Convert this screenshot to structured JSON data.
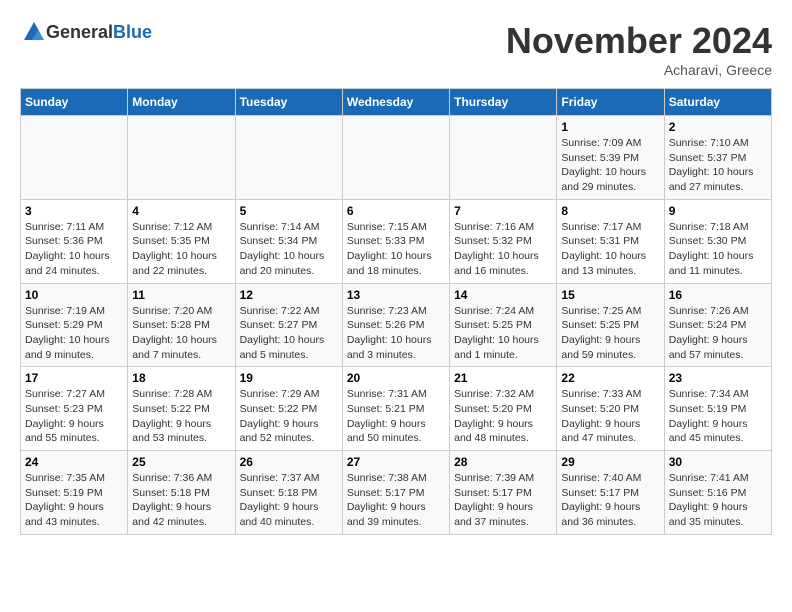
{
  "header": {
    "logo_general": "General",
    "logo_blue": "Blue",
    "month_title": "November 2024",
    "location": "Acharavi, Greece"
  },
  "days_of_week": [
    "Sunday",
    "Monday",
    "Tuesday",
    "Wednesday",
    "Thursday",
    "Friday",
    "Saturday"
  ],
  "weeks": [
    [
      {
        "day": "",
        "info": ""
      },
      {
        "day": "",
        "info": ""
      },
      {
        "day": "",
        "info": ""
      },
      {
        "day": "",
        "info": ""
      },
      {
        "day": "",
        "info": ""
      },
      {
        "day": "1",
        "info": "Sunrise: 7:09 AM\nSunset: 5:39 PM\nDaylight: 10 hours and 29 minutes."
      },
      {
        "day": "2",
        "info": "Sunrise: 7:10 AM\nSunset: 5:37 PM\nDaylight: 10 hours and 27 minutes."
      }
    ],
    [
      {
        "day": "3",
        "info": "Sunrise: 7:11 AM\nSunset: 5:36 PM\nDaylight: 10 hours and 24 minutes."
      },
      {
        "day": "4",
        "info": "Sunrise: 7:12 AM\nSunset: 5:35 PM\nDaylight: 10 hours and 22 minutes."
      },
      {
        "day": "5",
        "info": "Sunrise: 7:14 AM\nSunset: 5:34 PM\nDaylight: 10 hours and 20 minutes."
      },
      {
        "day": "6",
        "info": "Sunrise: 7:15 AM\nSunset: 5:33 PM\nDaylight: 10 hours and 18 minutes."
      },
      {
        "day": "7",
        "info": "Sunrise: 7:16 AM\nSunset: 5:32 PM\nDaylight: 10 hours and 16 minutes."
      },
      {
        "day": "8",
        "info": "Sunrise: 7:17 AM\nSunset: 5:31 PM\nDaylight: 10 hours and 13 minutes."
      },
      {
        "day": "9",
        "info": "Sunrise: 7:18 AM\nSunset: 5:30 PM\nDaylight: 10 hours and 11 minutes."
      }
    ],
    [
      {
        "day": "10",
        "info": "Sunrise: 7:19 AM\nSunset: 5:29 PM\nDaylight: 10 hours and 9 minutes."
      },
      {
        "day": "11",
        "info": "Sunrise: 7:20 AM\nSunset: 5:28 PM\nDaylight: 10 hours and 7 minutes."
      },
      {
        "day": "12",
        "info": "Sunrise: 7:22 AM\nSunset: 5:27 PM\nDaylight: 10 hours and 5 minutes."
      },
      {
        "day": "13",
        "info": "Sunrise: 7:23 AM\nSunset: 5:26 PM\nDaylight: 10 hours and 3 minutes."
      },
      {
        "day": "14",
        "info": "Sunrise: 7:24 AM\nSunset: 5:25 PM\nDaylight: 10 hours and 1 minute."
      },
      {
        "day": "15",
        "info": "Sunrise: 7:25 AM\nSunset: 5:25 PM\nDaylight: 9 hours and 59 minutes."
      },
      {
        "day": "16",
        "info": "Sunrise: 7:26 AM\nSunset: 5:24 PM\nDaylight: 9 hours and 57 minutes."
      }
    ],
    [
      {
        "day": "17",
        "info": "Sunrise: 7:27 AM\nSunset: 5:23 PM\nDaylight: 9 hours and 55 minutes."
      },
      {
        "day": "18",
        "info": "Sunrise: 7:28 AM\nSunset: 5:22 PM\nDaylight: 9 hours and 53 minutes."
      },
      {
        "day": "19",
        "info": "Sunrise: 7:29 AM\nSunset: 5:22 PM\nDaylight: 9 hours and 52 minutes."
      },
      {
        "day": "20",
        "info": "Sunrise: 7:31 AM\nSunset: 5:21 PM\nDaylight: 9 hours and 50 minutes."
      },
      {
        "day": "21",
        "info": "Sunrise: 7:32 AM\nSunset: 5:20 PM\nDaylight: 9 hours and 48 minutes."
      },
      {
        "day": "22",
        "info": "Sunrise: 7:33 AM\nSunset: 5:20 PM\nDaylight: 9 hours and 47 minutes."
      },
      {
        "day": "23",
        "info": "Sunrise: 7:34 AM\nSunset: 5:19 PM\nDaylight: 9 hours and 45 minutes."
      }
    ],
    [
      {
        "day": "24",
        "info": "Sunrise: 7:35 AM\nSunset: 5:19 PM\nDaylight: 9 hours and 43 minutes."
      },
      {
        "day": "25",
        "info": "Sunrise: 7:36 AM\nSunset: 5:18 PM\nDaylight: 9 hours and 42 minutes."
      },
      {
        "day": "26",
        "info": "Sunrise: 7:37 AM\nSunset: 5:18 PM\nDaylight: 9 hours and 40 minutes."
      },
      {
        "day": "27",
        "info": "Sunrise: 7:38 AM\nSunset: 5:17 PM\nDaylight: 9 hours and 39 minutes."
      },
      {
        "day": "28",
        "info": "Sunrise: 7:39 AM\nSunset: 5:17 PM\nDaylight: 9 hours and 37 minutes."
      },
      {
        "day": "29",
        "info": "Sunrise: 7:40 AM\nSunset: 5:17 PM\nDaylight: 9 hours and 36 minutes."
      },
      {
        "day": "30",
        "info": "Sunrise: 7:41 AM\nSunset: 5:16 PM\nDaylight: 9 hours and 35 minutes."
      }
    ]
  ]
}
